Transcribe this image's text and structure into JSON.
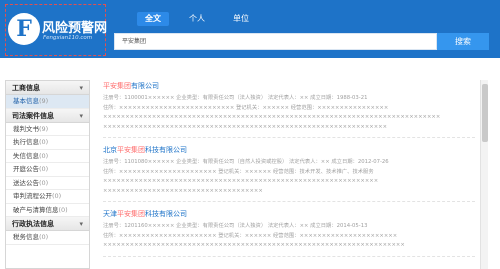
{
  "header": {
    "logo_glyph": "F",
    "logo_title": "风险预警网",
    "logo_domain": "Fengxian110.com",
    "tabs": [
      {
        "label": "全文",
        "active": true
      },
      {
        "label": "个人",
        "active": false
      },
      {
        "label": "单位",
        "active": false
      }
    ],
    "search_value": "平安集团",
    "search_button": "搜索",
    "bg_color": "#1e73c8"
  },
  "sidebar": {
    "sections": [
      {
        "heading": "工商信息",
        "items": [
          {
            "label": "基本信息",
            "count": "(9)",
            "selected": true
          }
        ]
      },
      {
        "heading": "司法案件信息",
        "items": [
          {
            "label": "裁判文书",
            "count": "(9)",
            "selected": false
          },
          {
            "label": "执行信息",
            "count": "(0)",
            "selected": false
          },
          {
            "label": "失信信息",
            "count": "(0)",
            "selected": false
          },
          {
            "label": "开庭公告",
            "count": "(0)",
            "selected": false
          },
          {
            "label": "送达公告",
            "count": "(0)",
            "selected": false
          },
          {
            "label": "审判流程公开",
            "count": "(0)",
            "selected": false
          },
          {
            "label": "破产与清算信息",
            "count": "(0)",
            "selected": false
          }
        ]
      },
      {
        "heading": "行政执法信息",
        "items": [
          {
            "label": "税务信息",
            "count": "(0)",
            "selected": false
          }
        ]
      }
    ]
  },
  "results": [
    {
      "prefix": "",
      "highlight": "平安集团",
      "suffix": "有限公司",
      "lines": [
        "注册号：1100001××××××  企业类型：有限责任公司（法人独资）  法定代表人：××  成立日期：1988-03-21",
        "住所：××××××××××××××××××××××××××  登记机关：××××××  经营范围：××××××××××××××××",
        "××××××××××××××××××××××××××××××××××××××××××××××××××××××××××××××××××××××××××××",
        "××××××××××××××××××××××××××××××××××××××××××××××××××××××××××××××××"
      ]
    },
    {
      "prefix": "北京",
      "highlight": "平安集团",
      "suffix": "科技有限公司",
      "lines": [
        "注册号：1101080××××××  企业类型：有限责任公司（自然人投资或控股）  法定代表人：××  成立日期：2012-07-26",
        "住所：××××××××××××××××××××××  登记机关：××××××  经营范围：技术开发、技术推广、技术服务",
        "××××××××××××××××××××××××××××××××××××××××××××××××××××××××××××××",
        "××××××××××××××××××××××××××××××××××××"
      ]
    },
    {
      "prefix": "天津",
      "highlight": "平安集团",
      "suffix": "科技有限公司",
      "lines": [
        "注册号：1201160××××××  企业类型：有限责任公司（法人独资）  法定代表人：××  成立日期：2014-05-13",
        "住所：××××××××××××××××××××××  登记机关：××××××  经营范围：××××××××××××××××××××××",
        "××××××××××××××××××××××××××××××××××××××××××××××××××××××××××××××××××××"
      ]
    }
  ]
}
